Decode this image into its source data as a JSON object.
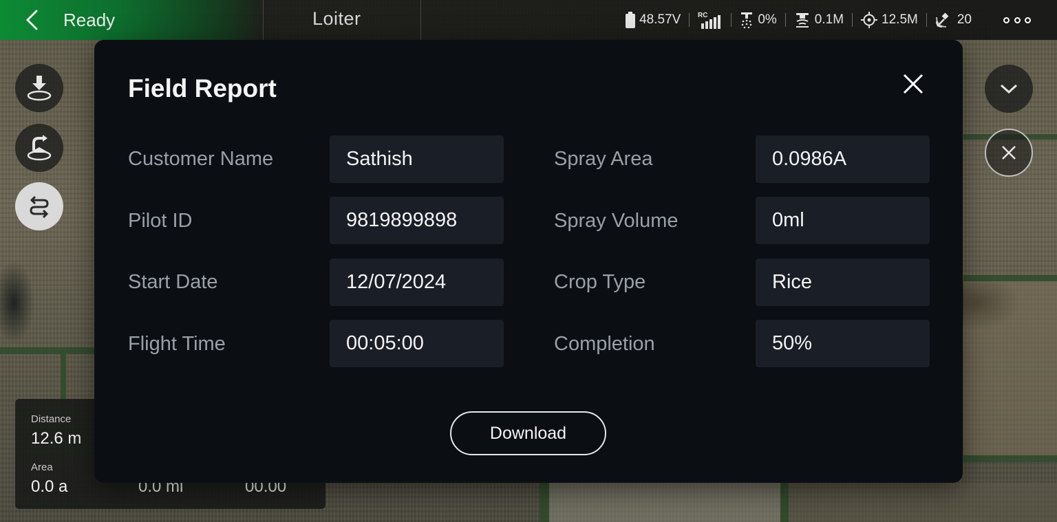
{
  "statusbar": {
    "flight_status": "Ready",
    "flight_mode": "Loiter",
    "battery_voltage": "48.57V",
    "rc_label": "RC",
    "spray_percent": "0%",
    "radar_height": "0.1M",
    "distance": "12.5M",
    "satellites": "20",
    "status_color": "#0d8a34"
  },
  "stats_panel": {
    "distance_label": "Distance",
    "distance_value": "12.6 m",
    "area_label": "Area",
    "area_value": "0.0 a",
    "partial_value_2": "0.0 mi",
    "partial_value_3": "00.00"
  },
  "modal": {
    "title": "Field Report",
    "fields_left": [
      {
        "label": "Customer Name",
        "value": "Sathish"
      },
      {
        "label": "Pilot ID",
        "value": "9819899898"
      },
      {
        "label": "Start Date",
        "value": "12/07/2024"
      },
      {
        "label": "Flight Time",
        "value": "00:05:00"
      }
    ],
    "fields_right": [
      {
        "label": "Spray Area",
        "value": "0.0986A"
      },
      {
        "label": "Spray Volume",
        "value": "0ml"
      },
      {
        "label": "Crop Type",
        "value": "Rice"
      },
      {
        "label": "Completion",
        "value": "50%"
      }
    ],
    "download_label": "Download",
    "background_color": "#0b0f14",
    "field_bg_color": "#1a1e26"
  }
}
